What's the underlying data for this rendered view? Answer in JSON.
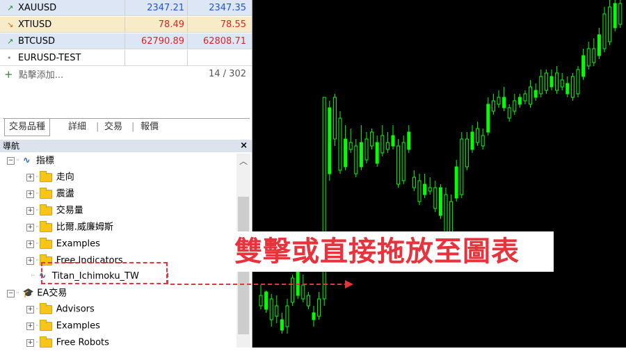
{
  "market_watch": {
    "rows": [
      {
        "trend": "up",
        "symbol": "XAUUSD",
        "bid": "2347.21",
        "ask": "2347.35",
        "highlight": "#dde6f5",
        "price_color": "#2255cc"
      },
      {
        "trend": "down",
        "symbol": "XTIUSD",
        "bid": "78.49",
        "ask": "78.55",
        "highlight": "#f8ecc8",
        "price_color": "#dd2222"
      },
      {
        "trend": "up",
        "symbol": "BTCUSD",
        "bid": "62790.89",
        "ask": "62808.71",
        "highlight": "#dde6f5",
        "price_color": "#dd2222"
      },
      {
        "trend": "none",
        "symbol": "EURUSD-TEST",
        "bid": "",
        "ask": "",
        "highlight": "#ffffff",
        "price_color": "#000000"
      }
    ],
    "add_label": "點擊添加...",
    "count": "14 / 302",
    "tabs": [
      "交易品種",
      "詳細",
      "交易",
      "報價"
    ]
  },
  "navigator": {
    "title": "導航",
    "close": "×",
    "indicators_label": "指標",
    "indicator_folders": [
      "走向",
      "震盪",
      "交易量",
      "比爾.威廉姆斯",
      "Examples",
      "Free Indicators"
    ],
    "selected_indicator": "Titan_Ichimoku_TW",
    "ea_label": "EA交易",
    "ea_folders": [
      "Advisors",
      "Examples",
      "Free Robots"
    ]
  },
  "annotation": {
    "text": "雙擊或直接拖放至圖表",
    "color": "#e8323c"
  },
  "chart_data": {
    "type": "candlestick",
    "bull_color": "#00ff00",
    "background": "#000000",
    "candles": [
      [
        410,
        440,
        425,
        445
      ],
      [
        418,
        445,
        420,
        450
      ],
      [
        423,
        460,
        430,
        470
      ],
      [
        425,
        455,
        440,
        465
      ],
      [
        450,
        475,
        460,
        480
      ],
      [
        430,
        470,
        440,
        480
      ],
      [
        395,
        435,
        400,
        440
      ],
      [
        380,
        425,
        385,
        430
      ],
      [
        395,
        430,
        410,
        435
      ],
      [
        420,
        440,
        425,
        445
      ],
      [
        440,
        460,
        450,
        470
      ],
      [
        420,
        455,
        430,
        460
      ],
      [
        150,
        430,
        140,
        440
      ],
      [
        145,
        250,
        155,
        260
      ],
      [
        135,
        200,
        140,
        210
      ],
      [
        160,
        245,
        170,
        250
      ],
      [
        180,
        240,
        200,
        245
      ],
      [
        185,
        215,
        205,
        220
      ],
      [
        200,
        250,
        210,
        255
      ],
      [
        180,
        240,
        205,
        245
      ],
      [
        190,
        230,
        200,
        235
      ],
      [
        185,
        210,
        190,
        215
      ],
      [
        195,
        235,
        205,
        240
      ],
      [
        180,
        220,
        195,
        225
      ],
      [
        190,
        215,
        205,
        220
      ],
      [
        180,
        210,
        195,
        215
      ],
      [
        200,
        265,
        210,
        270
      ],
      [
        195,
        260,
        205,
        265
      ],
      [
        180,
        215,
        190,
        220
      ],
      [
        245,
        270,
        255,
        275
      ],
      [
        250,
        290,
        260,
        295
      ],
      [
        250,
        280,
        265,
        285
      ],
      [
        255,
        275,
        270,
        280
      ],
      [
        260,
        300,
        270,
        305
      ],
      [
        265,
        310,
        270,
        315
      ],
      [
        270,
        340,
        280,
        345
      ],
      [
        280,
        380,
        290,
        390
      ],
      [
        230,
        285,
        240,
        290
      ],
      [
        190,
        280,
        200,
        285
      ],
      [
        190,
        240,
        200,
        245
      ],
      [
        180,
        215,
        190,
        220
      ],
      [
        175,
        205,
        185,
        210
      ],
      [
        185,
        210,
        195,
        215
      ],
      [
        140,
        190,
        150,
        195
      ],
      [
        135,
        160,
        145,
        165
      ],
      [
        130,
        150,
        140,
        155
      ],
      [
        125,
        155,
        140,
        160
      ],
      [
        150,
        170,
        155,
        175
      ],
      [
        135,
        160,
        145,
        165
      ],
      [
        135,
        150,
        140,
        155
      ],
      [
        130,
        145,
        135,
        150
      ],
      [
        115,
        150,
        125,
        155
      ],
      [
        120,
        140,
        130,
        145
      ],
      [
        100,
        135,
        110,
        140
      ],
      [
        100,
        130,
        105,
        135
      ],
      [
        100,
        125,
        110,
        130
      ],
      [
        95,
        130,
        105,
        135
      ],
      [
        105,
        125,
        115,
        130
      ],
      [
        110,
        135,
        120,
        140
      ],
      [
        105,
        140,
        110,
        145
      ],
      [
        95,
        135,
        100,
        140
      ],
      [
        70,
        110,
        80,
        115
      ],
      [
        60,
        95,
        70,
        100
      ],
      [
        55,
        90,
        70,
        95
      ],
      [
        40,
        80,
        50,
        85
      ],
      [
        10,
        70,
        20,
        75
      ],
      [
        0,
        60,
        10,
        65
      ],
      [
        0,
        40,
        5,
        45
      ],
      [
        0,
        35,
        5,
        40
      ]
    ]
  }
}
